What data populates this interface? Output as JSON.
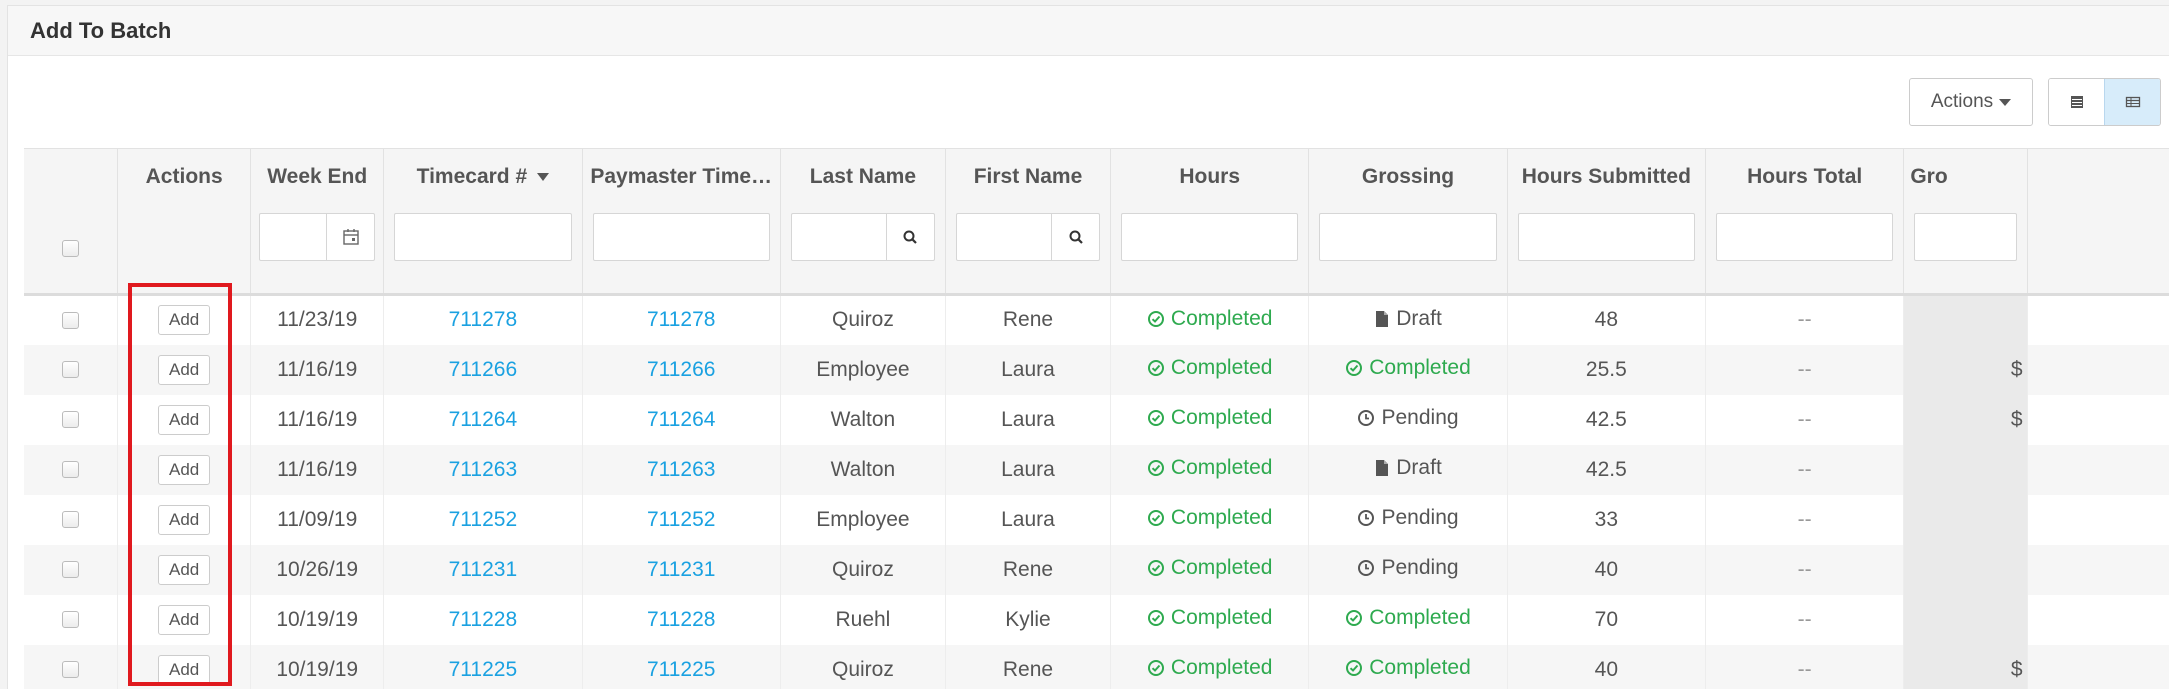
{
  "panel": {
    "title": "Add To Batch"
  },
  "toolbar": {
    "actions_label": "Actions"
  },
  "columns": {
    "actions": "Actions",
    "week_end": "Week End",
    "timecard": "Timecard #",
    "paymaster": "Paymaster Time…",
    "last_name": "Last Name",
    "first_name": "First Name",
    "hours": "Hours",
    "grossing": "Grossing",
    "hours_submitted": "Hours Submitted",
    "hours_total": "Hours Total",
    "gross": "Gro"
  },
  "rows": [
    {
      "add": "Add",
      "week_end": "11/23/19",
      "timecard": "711278",
      "paymaster": "711278",
      "last_name": "Quiroz",
      "first_name": "Rene",
      "hours": "Completed",
      "grossing": "Draft",
      "grossing_status": "draft",
      "hours_submitted": "48",
      "hours_total": "--",
      "gross": ""
    },
    {
      "add": "Add",
      "week_end": "11/16/19",
      "timecard": "711266",
      "paymaster": "711266",
      "last_name": "Employee",
      "first_name": "Laura",
      "hours": "Completed",
      "grossing": "Completed",
      "grossing_status": "completed",
      "hours_submitted": "25.5",
      "hours_total": "--",
      "gross": "$"
    },
    {
      "add": "Add",
      "week_end": "11/16/19",
      "timecard": "711264",
      "paymaster": "711264",
      "last_name": "Walton",
      "first_name": "Laura",
      "hours": "Completed",
      "grossing": "Pending",
      "grossing_status": "pending",
      "hours_submitted": "42.5",
      "hours_total": "--",
      "gross": "$"
    },
    {
      "add": "Add",
      "week_end": "11/16/19",
      "timecard": "711263",
      "paymaster": "711263",
      "last_name": "Walton",
      "first_name": "Laura",
      "hours": "Completed",
      "grossing": "Draft",
      "grossing_status": "draft",
      "hours_submitted": "42.5",
      "hours_total": "--",
      "gross": ""
    },
    {
      "add": "Add",
      "week_end": "11/09/19",
      "timecard": "711252",
      "paymaster": "711252",
      "last_name": "Employee",
      "first_name": "Laura",
      "hours": "Completed",
      "grossing": "Pending",
      "grossing_status": "pending",
      "hours_submitted": "33",
      "hours_total": "--",
      "gross": ""
    },
    {
      "add": "Add",
      "week_end": "10/26/19",
      "timecard": "711231",
      "paymaster": "711231",
      "last_name": "Quiroz",
      "first_name": "Rene",
      "hours": "Completed",
      "grossing": "Pending",
      "grossing_status": "pending",
      "hours_submitted": "40",
      "hours_total": "--",
      "gross": ""
    },
    {
      "add": "Add",
      "week_end": "10/19/19",
      "timecard": "711228",
      "paymaster": "711228",
      "last_name": "Ruehl",
      "first_name": "Kylie",
      "hours": "Completed",
      "grossing": "Completed",
      "grossing_status": "completed",
      "hours_submitted": "70",
      "hours_total": "--",
      "gross": ""
    },
    {
      "add": "Add",
      "week_end": "10/19/19",
      "timecard": "711225",
      "paymaster": "711225",
      "last_name": "Quiroz",
      "first_name": "Rene",
      "hours": "Completed",
      "grossing": "Completed",
      "grossing_status": "completed",
      "hours_submitted": "40",
      "hours_total": "--",
      "gross": "$"
    }
  ],
  "colors": {
    "link": "#1aa1e1",
    "completed": "#2eaa4f",
    "highlight": "#e0191e"
  }
}
